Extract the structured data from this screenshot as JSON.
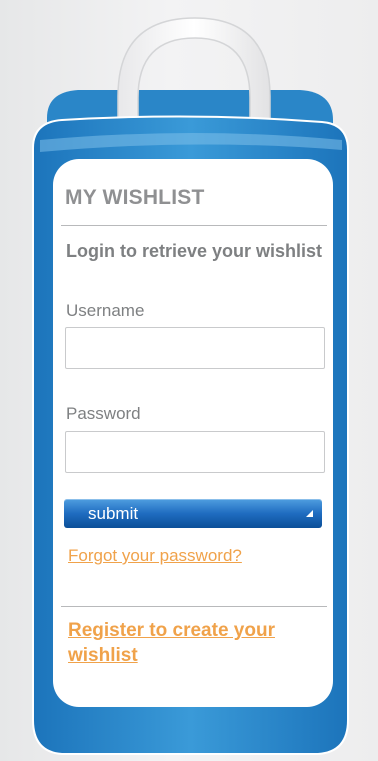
{
  "colors": {
    "bag_blue": "#2f8fd0",
    "bag_blue_dark": "#1a6fb4",
    "card_bg": "#ffffff",
    "heading_gray": "#8f9092",
    "text_gray": "#7e8082",
    "link_orange": "#f0a24a",
    "button_blue": "#1f6cc0"
  },
  "widget": {
    "title": "MY WISHLIST",
    "subtitle": "Login to retrieve your wishlist"
  },
  "form": {
    "username_label": "Username",
    "username_value": "",
    "password_label": "Password",
    "password_value": "",
    "submit_label": "submit"
  },
  "links": {
    "forgot_password": "Forgot your password?",
    "register": "Register to create your wishlist"
  },
  "icons": {
    "bag_handle": "shopping-bag-handle-icon",
    "submit_arrow": "corner-arrow-icon"
  }
}
